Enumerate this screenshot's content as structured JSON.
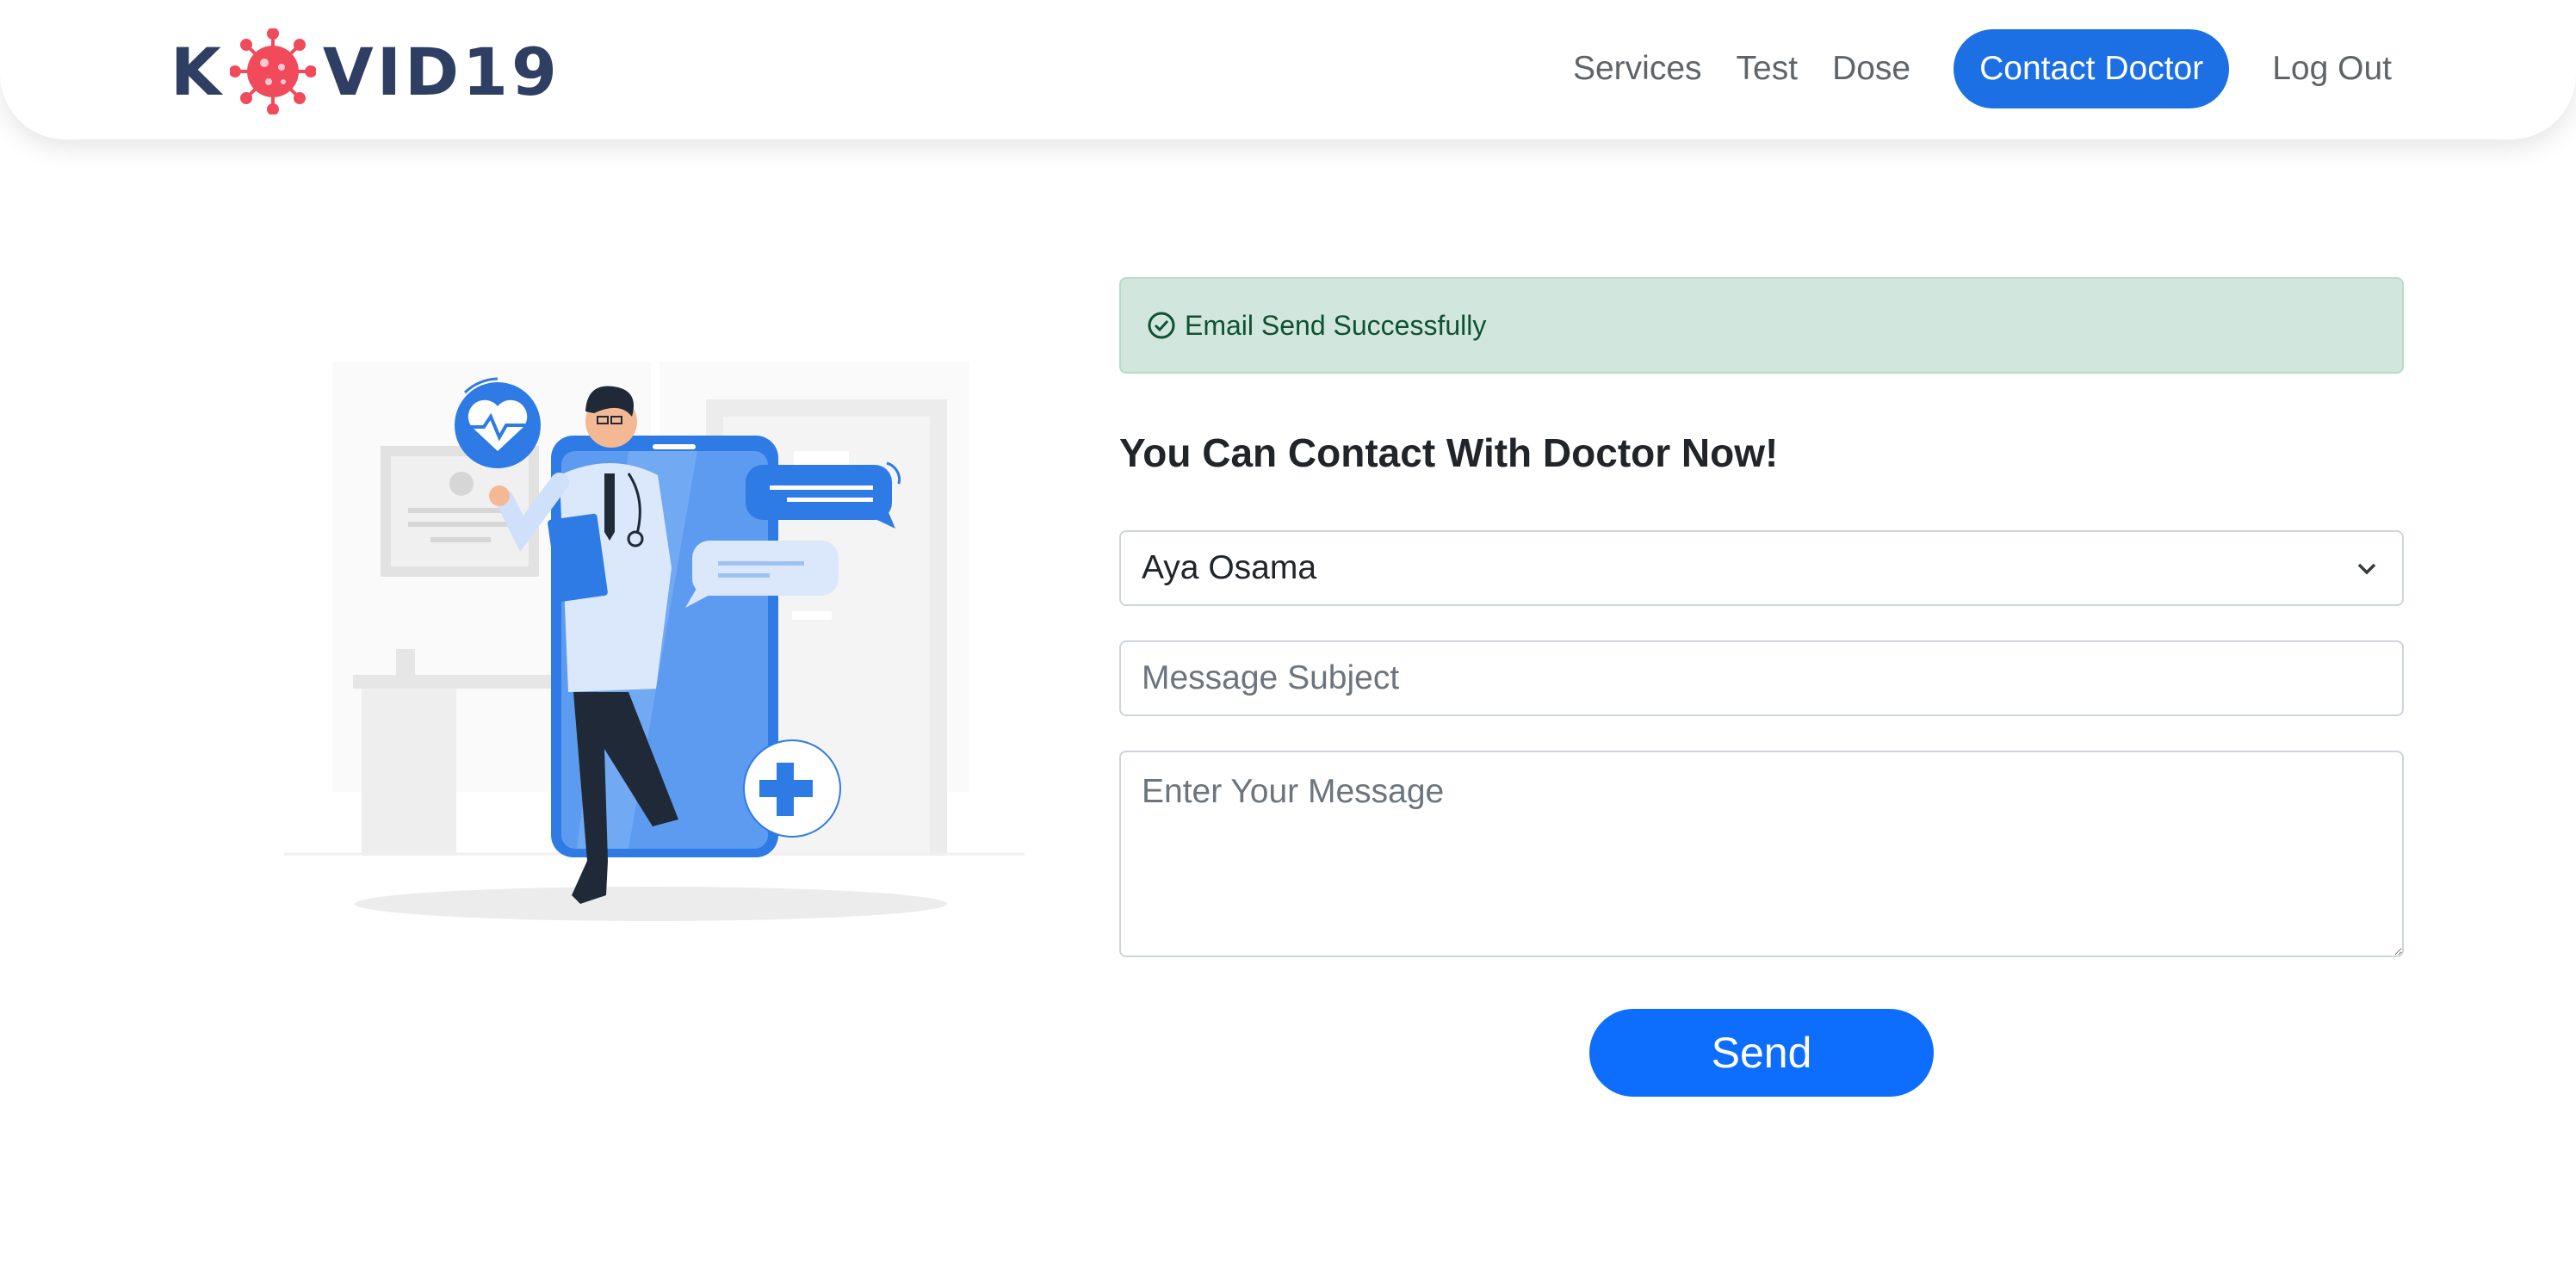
{
  "brand": {
    "prefix": "K",
    "suffix": "VID19",
    "virus_color": "#f04a5b",
    "text_color": "#2f3f63"
  },
  "nav": {
    "items": [
      {
        "label": "Services",
        "active": false
      },
      {
        "label": "Test",
        "active": false
      },
      {
        "label": "Dose",
        "active": false
      },
      {
        "label": "Contact Doctor",
        "active": true
      },
      {
        "label": "Log Out",
        "active": false
      }
    ],
    "active_color": "#1d6fe4"
  },
  "alert": {
    "icon": "check-circle-icon",
    "text": "Email Send Successfully",
    "bg": "#d1e7dd"
  },
  "form": {
    "heading": "You Can Contact With Doctor Now!",
    "doctor_select": {
      "value": "Aya Osama",
      "icon": "chevron-down-icon"
    },
    "subject": {
      "value": "",
      "placeholder": "Message Subject"
    },
    "message": {
      "value": "",
      "placeholder": "Enter Your Message"
    },
    "send_label": "Send",
    "send_color": "#0d6efd"
  },
  "illustration": {
    "accent": "#2f7be5",
    "name": "doctor-phone-illustration"
  }
}
